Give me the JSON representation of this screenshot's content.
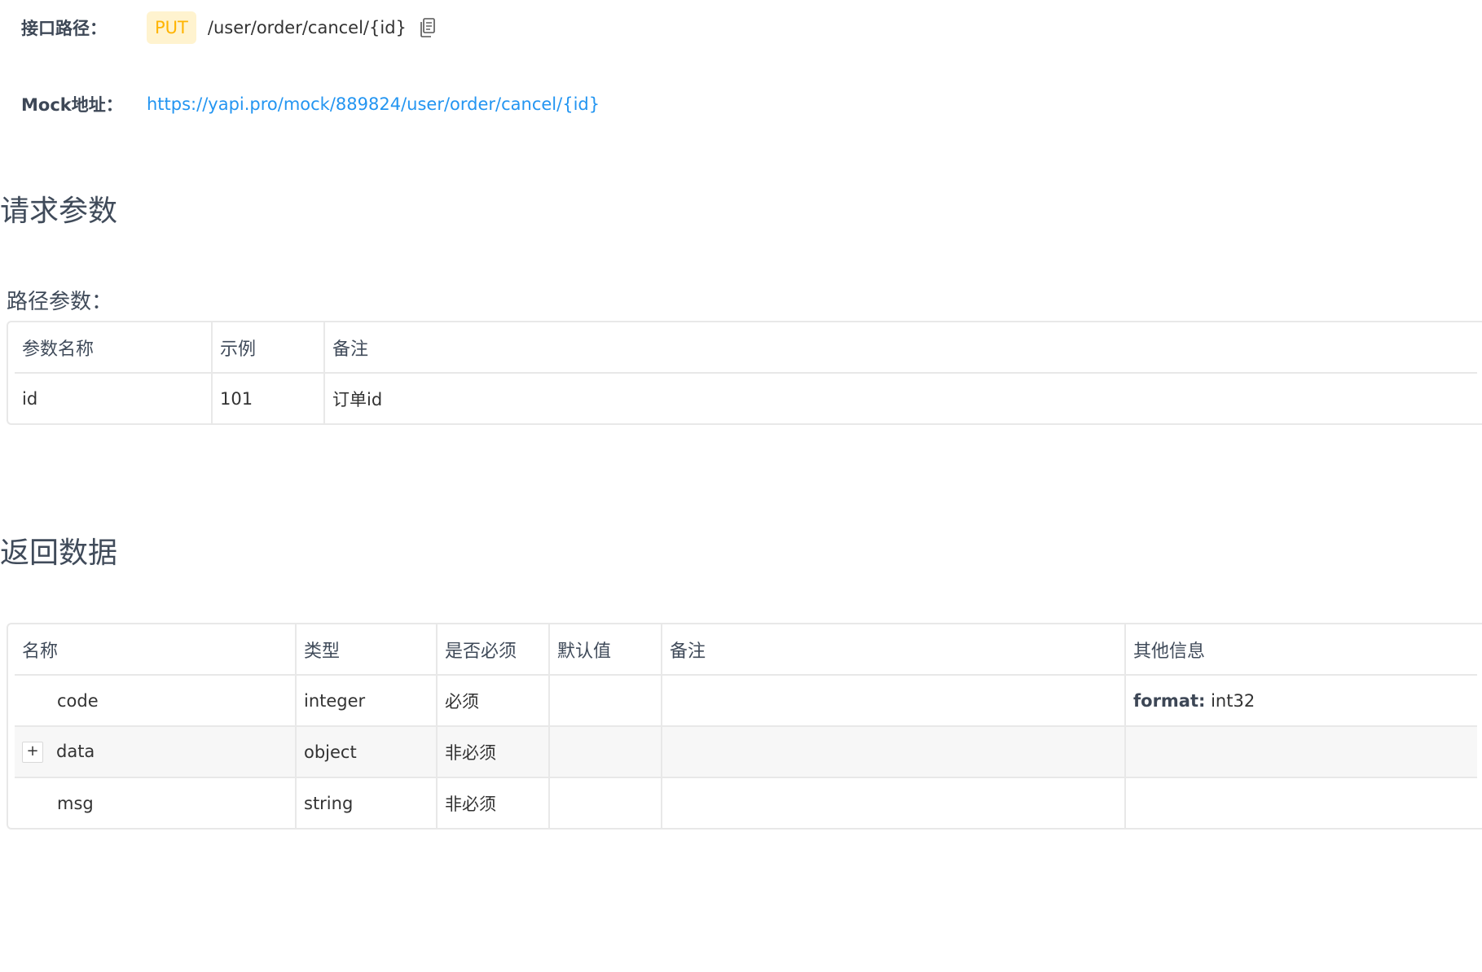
{
  "api": {
    "path_label": "接口路径：",
    "method": "PUT",
    "path": "/user/order/cancel/{id}",
    "copy_icon": "copy-document-icon",
    "mock_label": "Mock地址：",
    "mock_url": "https://yapi.pro/mock/889824/user/order/cancel/{id}"
  },
  "request": {
    "title": "请求参数",
    "path_params_title": "路径参数：",
    "columns": [
      "参数名称",
      "示例",
      "备注"
    ],
    "rows": [
      {
        "name": "id",
        "example": "101",
        "remark": "订单id"
      }
    ]
  },
  "response": {
    "title": "返回数据",
    "columns": [
      "名称",
      "类型",
      "是否必须",
      "默认值",
      "备注",
      "其他信息"
    ],
    "rows": [
      {
        "name": "code",
        "type": "integer",
        "required": "必须",
        "default": "",
        "remark": "",
        "other_key": "format:",
        "other_value": " int32",
        "expandable": false
      },
      {
        "name": "data",
        "type": "object",
        "required": "非必须",
        "default": "",
        "remark": "",
        "other_key": "",
        "other_value": "",
        "expandable": true,
        "expand_symbol": "+"
      },
      {
        "name": "msg",
        "type": "string",
        "required": "非必须",
        "default": "",
        "remark": "",
        "other_key": "",
        "other_value": "",
        "expandable": false
      }
    ]
  },
  "colors": {
    "badge_bg": "#fff3cf",
    "badge_text": "#ffb400",
    "link": "#2395f1",
    "border": "#e8e8e8"
  }
}
